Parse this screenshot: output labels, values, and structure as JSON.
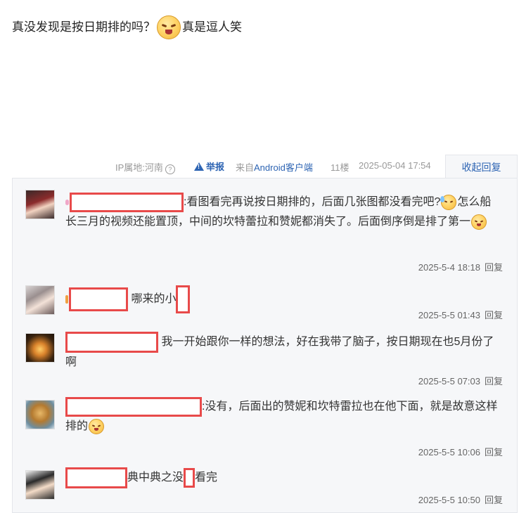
{
  "post": {
    "text_before": "真没发现是按日期排的吗？",
    "emoji_1": "laughing-emoji",
    "text_after": "真是逗人笑"
  },
  "meta": {
    "ip": "IP属地:河南",
    "help_icon": "?",
    "report": "举报",
    "from_prefix": "来自",
    "from_client": "Android客户端",
    "floor": "11楼",
    "time": "2025-05-04 17:54",
    "collapse": "收起回复"
  },
  "replies": [
    {
      "text_a": ":看图看完再说按日期排的，后面几张图都没看完吧?",
      "text_b": "怎么船长三月的视频还能置顶，中间的坎特蕾拉和赞妮都消失了。后面倒序倒是排了第一",
      "time": "2025-5-4 18:18",
      "reply": "回复"
    },
    {
      "text_a": "哪来的小",
      "time": "2025-5-5 01:43",
      "reply": "回复"
    },
    {
      "text_a": "我一开始跟你一样的想法，好在我带了脑子，按日期现在也5月份了啊",
      "time": "2025-5-5 07:03",
      "reply": "回复"
    },
    {
      "text_a": ":没有，后面出的赞妮和坎特雷拉也在他下面，就是故意这样排的",
      "time": "2025-5-5 10:06",
      "reply": "回复"
    },
    {
      "text_a": "典中典之没",
      "text_b": "看完",
      "time": "2025-5-5 10:50",
      "reply": "回复"
    }
  ],
  "colors": {
    "link": "#2d64b3",
    "redact": "#e84a4a",
    "panel_bg": "#f6f7f9"
  }
}
